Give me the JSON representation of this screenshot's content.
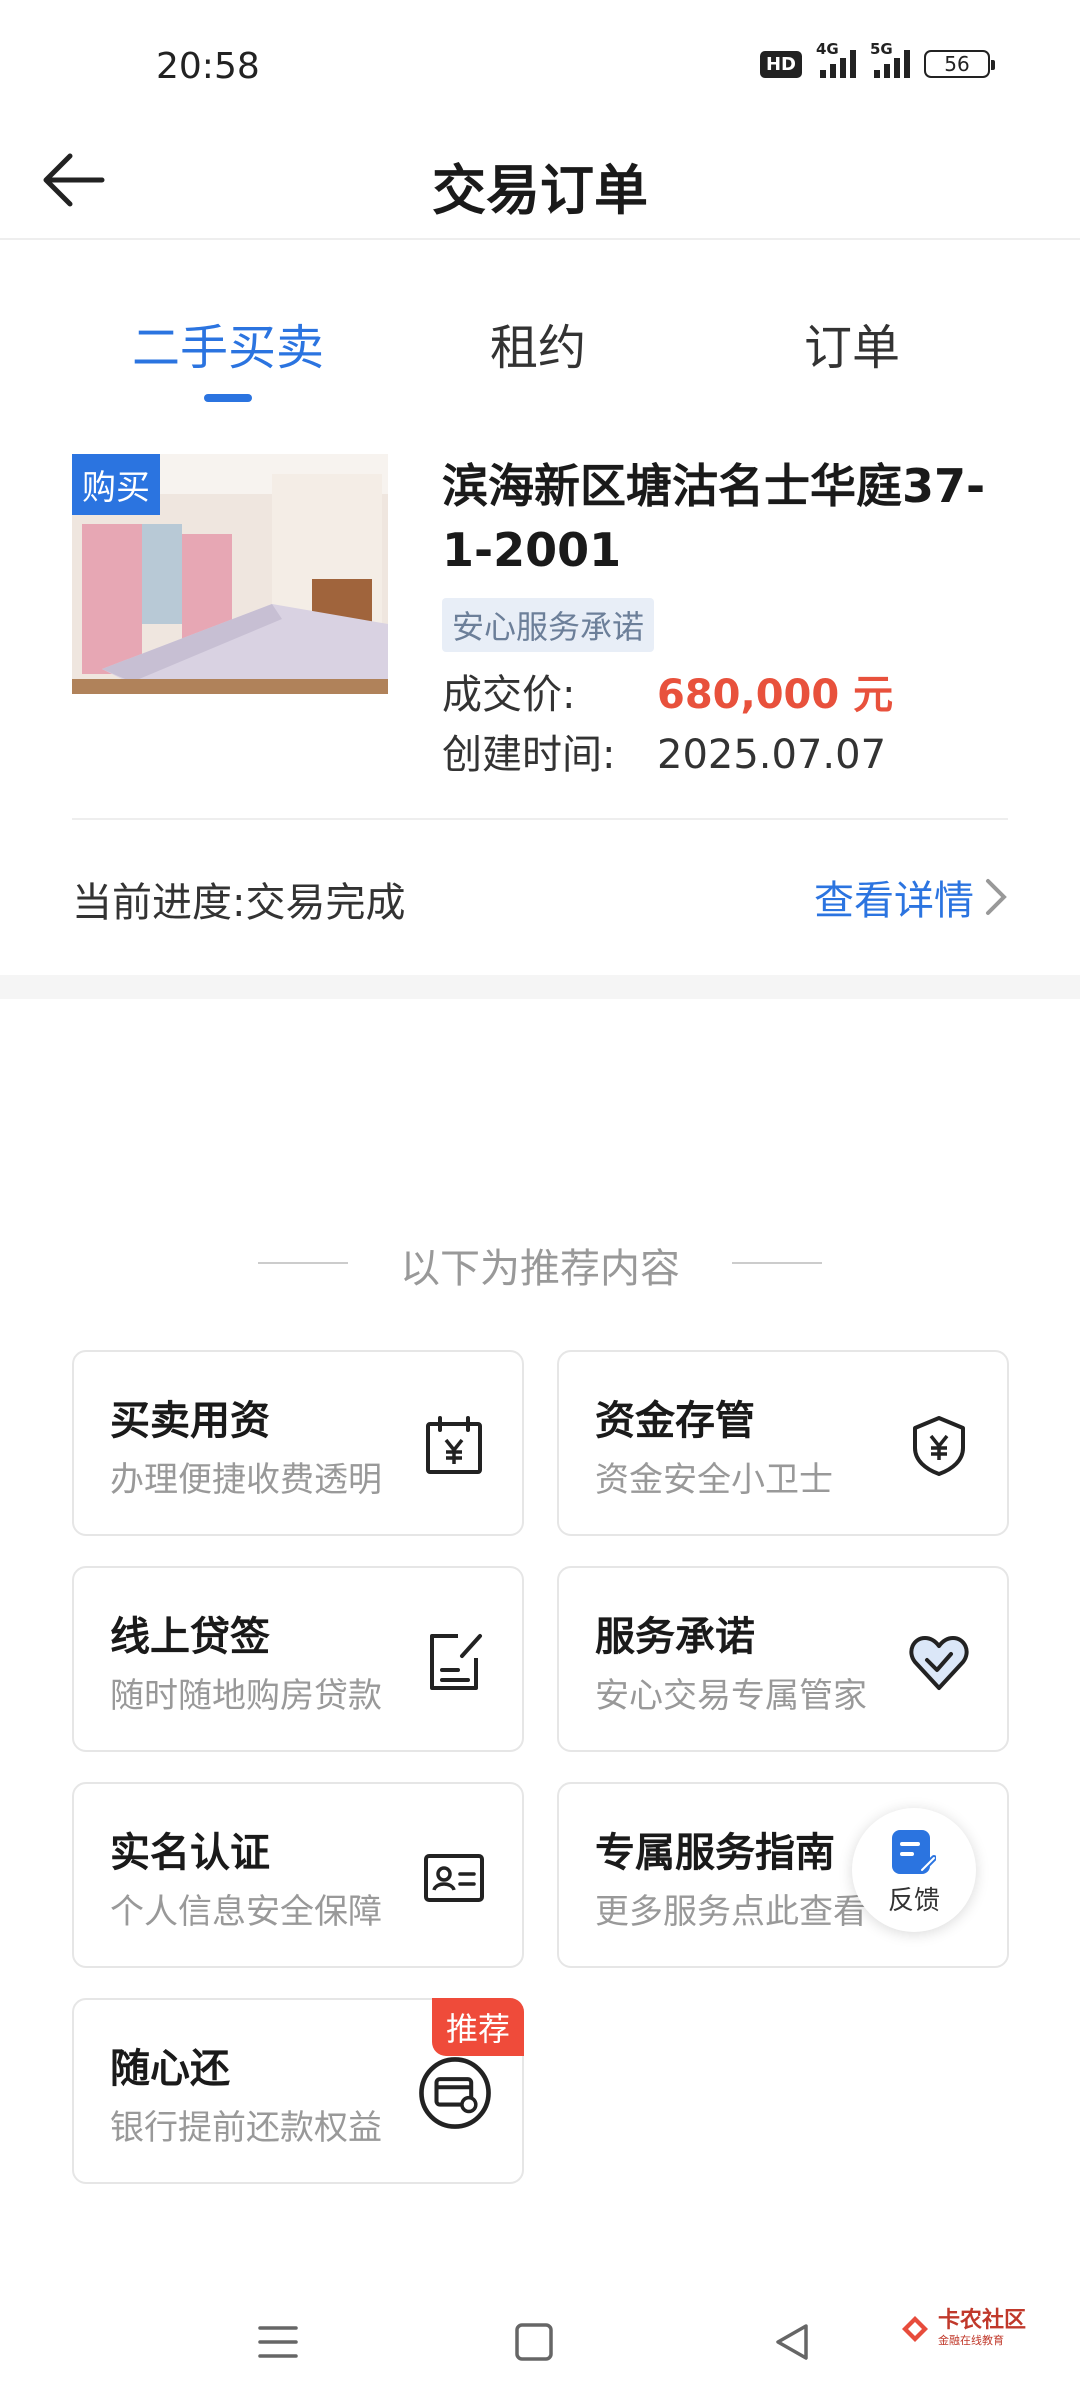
{
  "status_bar": {
    "time": "20:58",
    "hd": "HD",
    "net1": "4G",
    "net2": "5G",
    "battery": "56"
  },
  "header": {
    "title": "交易订单"
  },
  "tabs": [
    {
      "label": "二手买卖",
      "active": true
    },
    {
      "label": "租约",
      "active": false
    },
    {
      "label": "订单",
      "active": false
    }
  ],
  "order": {
    "badge": "购买",
    "title": "滨海新区塘沽名士华庭37-1-2001",
    "service_tag": "安心服务承诺",
    "price_label": "成交价:",
    "price_value": "680,000 元",
    "created_label": "创建时间:",
    "created_value": "2025.07.07",
    "progress": "当前进度:交易完成",
    "detail_link": "查看详情"
  },
  "recommend": {
    "title": "以下为推荐内容",
    "items": [
      {
        "title": "买卖用资",
        "subtitle": "办理便捷收费透明",
        "icon": "calendar-yuan-icon"
      },
      {
        "title": "资金存管",
        "subtitle": "资金安全小卫士",
        "icon": "shield-yuan-icon"
      },
      {
        "title": "线上贷签",
        "subtitle": "随时随地购房贷款",
        "icon": "sign-document-icon"
      },
      {
        "title": "服务承诺",
        "subtitle": "安心交易专属管家",
        "icon": "heart-check-icon"
      },
      {
        "title": "实名认证",
        "subtitle": "个人信息安全保障",
        "icon": "id-card-icon"
      },
      {
        "title": "专属服务指南",
        "subtitle": "更多服务点此查看",
        "icon": ""
      },
      {
        "title": "随心还",
        "subtitle": "银行提前还款权益",
        "icon": "card-clock-icon",
        "badge": "推荐"
      }
    ]
  },
  "feedback": {
    "label": "反馈"
  },
  "watermark": {
    "text": "卡农社区",
    "sub": "金融在线教育"
  },
  "colors": {
    "accent": "#2b74e0",
    "price": "#e8513c",
    "badge_hot": "#ef4b3a"
  }
}
